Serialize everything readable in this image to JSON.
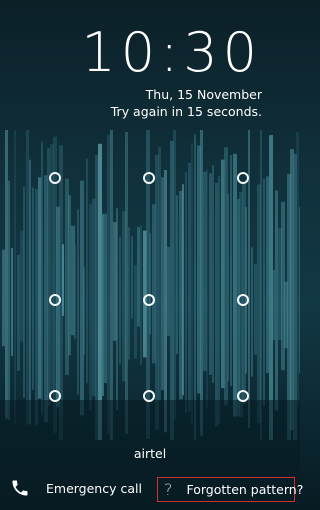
{
  "lockscreen": {
    "time": "10:30",
    "date": "Thu, 15 November",
    "status_message": "Try again in 15 seconds.",
    "carrier": "airtel"
  },
  "pattern": {
    "rows": 3,
    "columns": 3
  },
  "actions": {
    "emergency_call_label": "Emergency call",
    "forgotten_pattern_label": "Forgotten pattern?",
    "question_mark": "?"
  },
  "icons": {
    "phone": "phone-icon",
    "help": "question-mark-icon"
  },
  "colors": {
    "background_dark": "#0c2028",
    "wallpaper_bars": "#4a8d99",
    "text": "#ffffff",
    "highlight_border": "#d32f2f"
  }
}
